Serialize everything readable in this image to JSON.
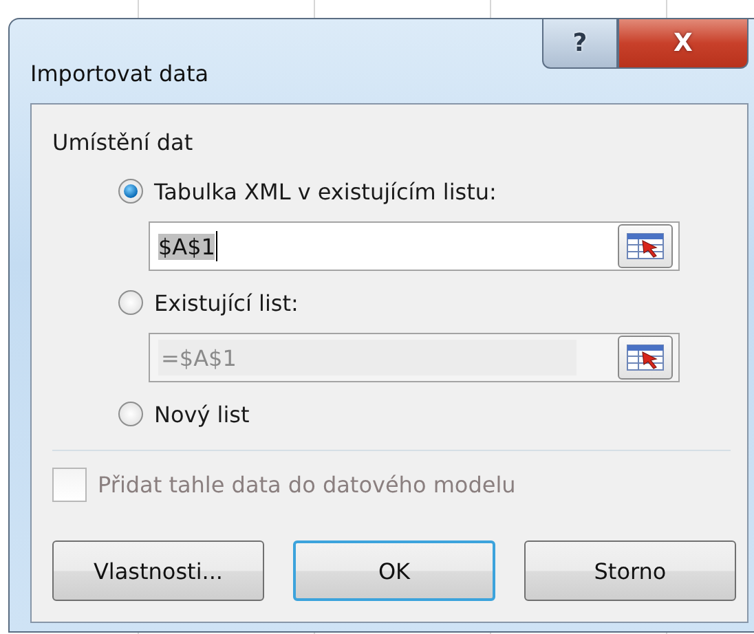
{
  "window": {
    "title": "Importovat data"
  },
  "title_buttons": [
    {
      "kind": "help",
      "label": "?"
    },
    {
      "kind": "close",
      "label": "X"
    }
  ],
  "group": {
    "label": "Umístění dat"
  },
  "options": [
    {
      "label": "Tabulka XML v existujícím listu:",
      "selected": true,
      "field": {
        "value": "$A$1",
        "disabled": false,
        "selected_text": true
      }
    },
    {
      "label": "Existující list:",
      "selected": false,
      "field": {
        "value": "=$A$1",
        "disabled": true,
        "selected_text": false
      }
    },
    {
      "label": "Nový list",
      "selected": false
    }
  ],
  "checkbox": {
    "label": "Přidat tahle data do datového modelu",
    "checked": false,
    "disabled": true
  },
  "buttons": [
    {
      "label": "Vlastnosti...",
      "default": false
    },
    {
      "label": "OK",
      "default": true
    },
    {
      "label": "Storno",
      "default": false
    }
  ]
}
